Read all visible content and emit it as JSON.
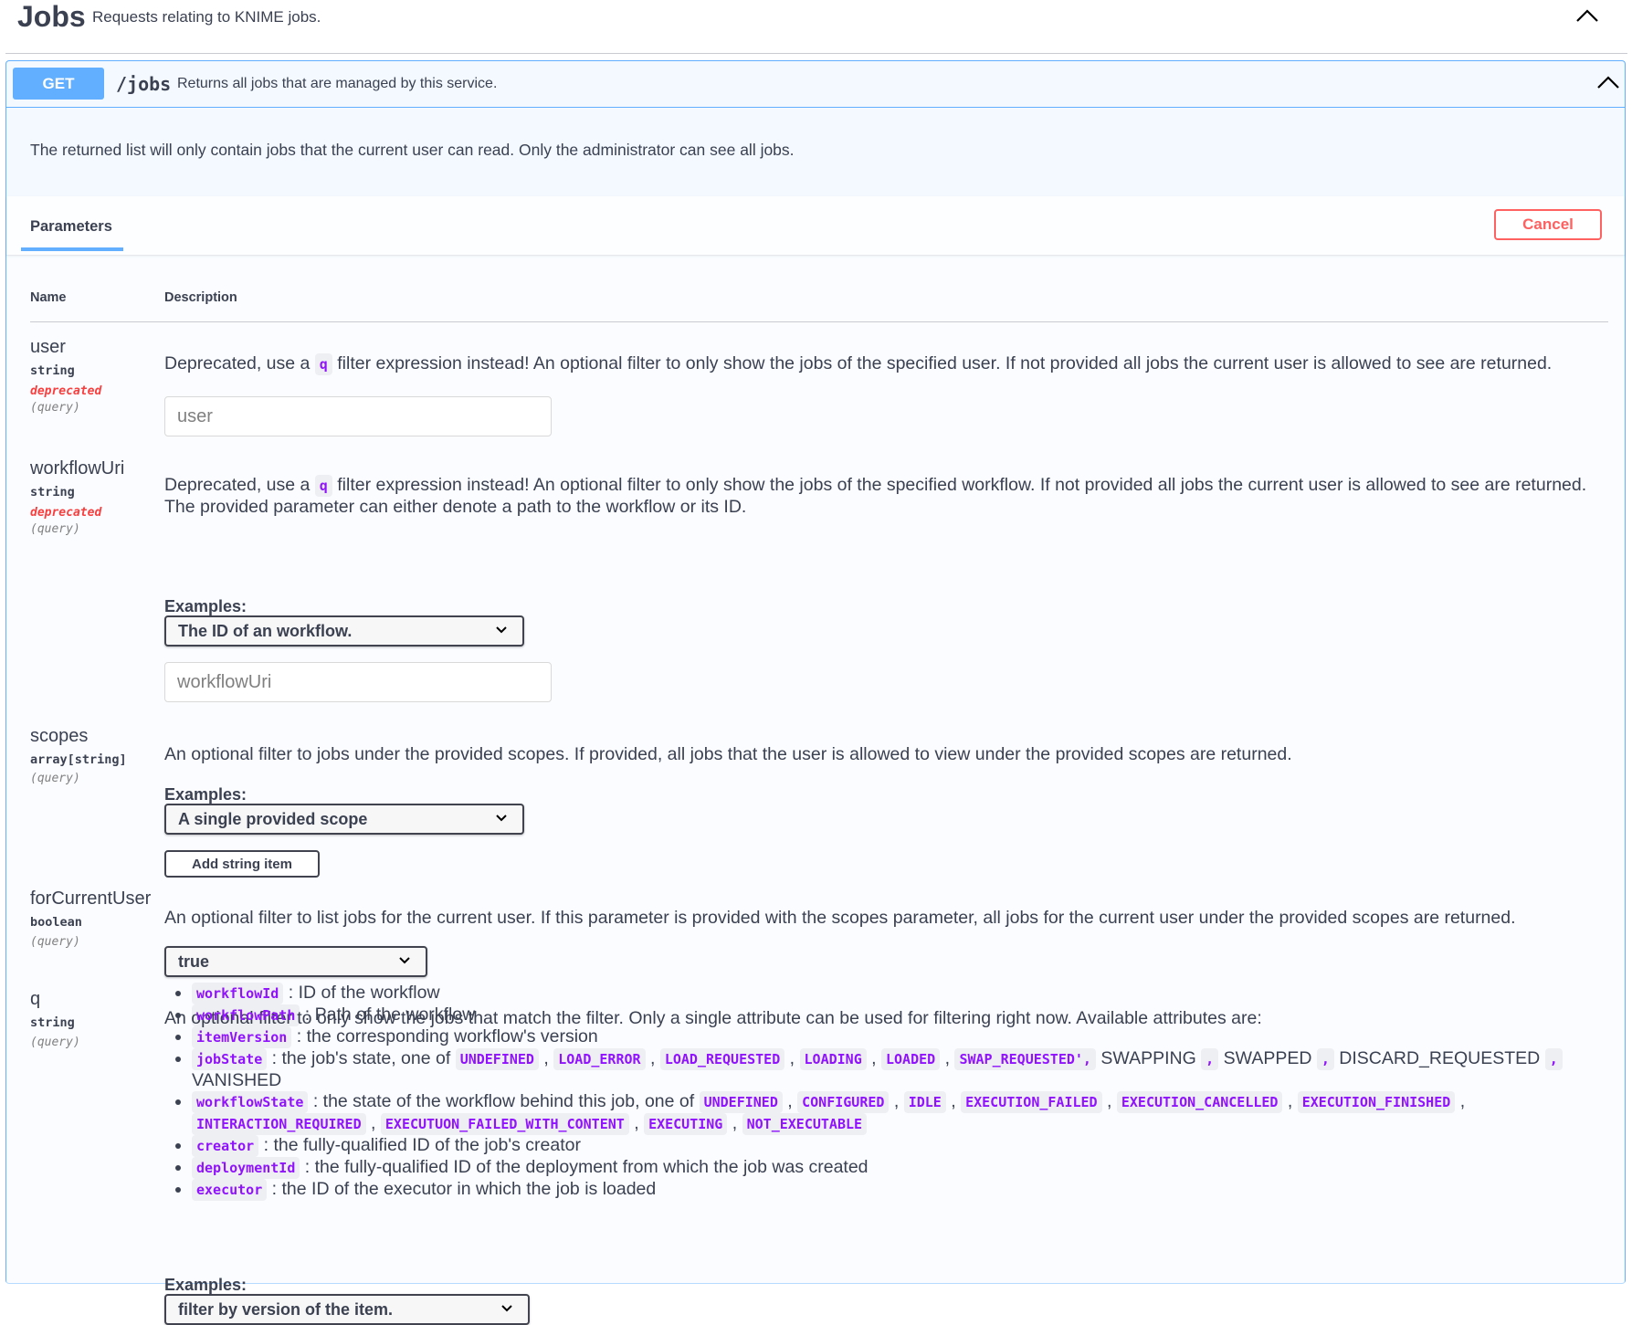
{
  "tag": {
    "title": "Jobs",
    "description": "Requests relating to KNIME jobs."
  },
  "operation": {
    "method": "GET",
    "path": "/jobs",
    "summary": "Returns all jobs that are managed by this service.",
    "description": "The returned list will only contain jobs that the current user can read. Only the administrator can see all jobs."
  },
  "tabs": {
    "parameters": "Parameters",
    "cancel": "Cancel"
  },
  "columns": {
    "name": "Name",
    "description": "Description"
  },
  "params": {
    "user": {
      "name": "user",
      "type": "string",
      "deprecated": "deprecated",
      "in": "(query)",
      "desc_a": "Deprecated, use a ",
      "code": "q",
      "desc_b": " filter expression instead! An optional filter to only show the jobs of the specified user. If not provided all jobs the current user is allowed to see are returned.",
      "placeholder": "user"
    },
    "workflowUri": {
      "name": "workflowUri",
      "type": "string",
      "deprecated": "deprecated",
      "in": "(query)",
      "desc_a": "Deprecated, use a ",
      "code": "q",
      "desc_b": " filter expression instead! An optional filter to only show the jobs of the specified workflow. If not provided all jobs the current user is allowed to see are returned. The provided parameter can either denote a path to the workflow or its ID.",
      "examples_label": "Examples:",
      "example_selected": "The ID of an workflow.",
      "placeholder": "workflowUri"
    },
    "scopes": {
      "name": "scopes",
      "type": "array[string]",
      "in": "(query)",
      "desc": "An optional filter to jobs under the provided scopes. If provided, all jobs that the user is allowed to view under the provided scopes are returned.",
      "examples_label": "Examples:",
      "example_selected": "A single provided scope",
      "add_item": "Add string item"
    },
    "forCurrentUser": {
      "name": "forCurrentUser",
      "type": "boolean",
      "in": "(query)",
      "desc": "An optional filter to list jobs for the current user. If this parameter is provided with the scopes parameter, all jobs for the current user under the provided scopes are returned.",
      "selected": "true"
    },
    "q": {
      "name": "q",
      "type": "string",
      "in": "(query)",
      "desc": "An optional filter to only show the jobs that match the filter. Only a single attribute can be used for filtering right now. Available attributes are:",
      "attributes": {
        "workflowId": {
          "code": "workflowId",
          "text": " : ID of the workflow"
        },
        "workflowPath": {
          "code": "workflowPath",
          "text": " : Path of the workflow"
        },
        "itemVersion": {
          "code": "itemVersion",
          "text": " : the corresponding workflow's version"
        },
        "jobState": {
          "code": "jobState",
          "text": " : the job's state, one of ",
          "values": [
            "UNDEFINED",
            "LOAD_ERROR",
            "LOAD_REQUESTED",
            "LOADING",
            "LOADED",
            "SWAP_REQUESTED',"
          ],
          "plain": [
            "SWAPPING",
            "SWAPPED",
            "DISCARD_REQUESTED",
            "VANISHED"
          ]
        },
        "workflowState": {
          "code": "workflowState",
          "text": " : the state of the workflow behind this job, one of ",
          "values": [
            "UNDEFINED",
            "CONFIGURED",
            "IDLE",
            "EXECUTION_FAILED",
            "EXECUTION_CANCELLED",
            "EXECUTION_FINISHED",
            "INTERACTION_REQUIRED",
            "EXECUTUON_FAILED_WITH_CONTENT",
            "EXECUTING",
            "NOT_EXECUTABLE"
          ]
        },
        "creator": {
          "code": "creator",
          "text": " : the fully-qualified ID of the job's creator"
        },
        "deploymentId": {
          "code": "deploymentId",
          "text": " : the fully-qualified ID of the deployment from which the job was created"
        },
        "executor": {
          "code": "executor",
          "text": " : the ID of the executor in which the job is loaded"
        }
      },
      "examples_label": "Examples:",
      "example_selected": "filter by version of the item."
    }
  },
  "colors": {
    "get": "#61affe",
    "cancel": "#ff6060",
    "deprecated": "#f93e3e",
    "code": "#9012fe"
  }
}
